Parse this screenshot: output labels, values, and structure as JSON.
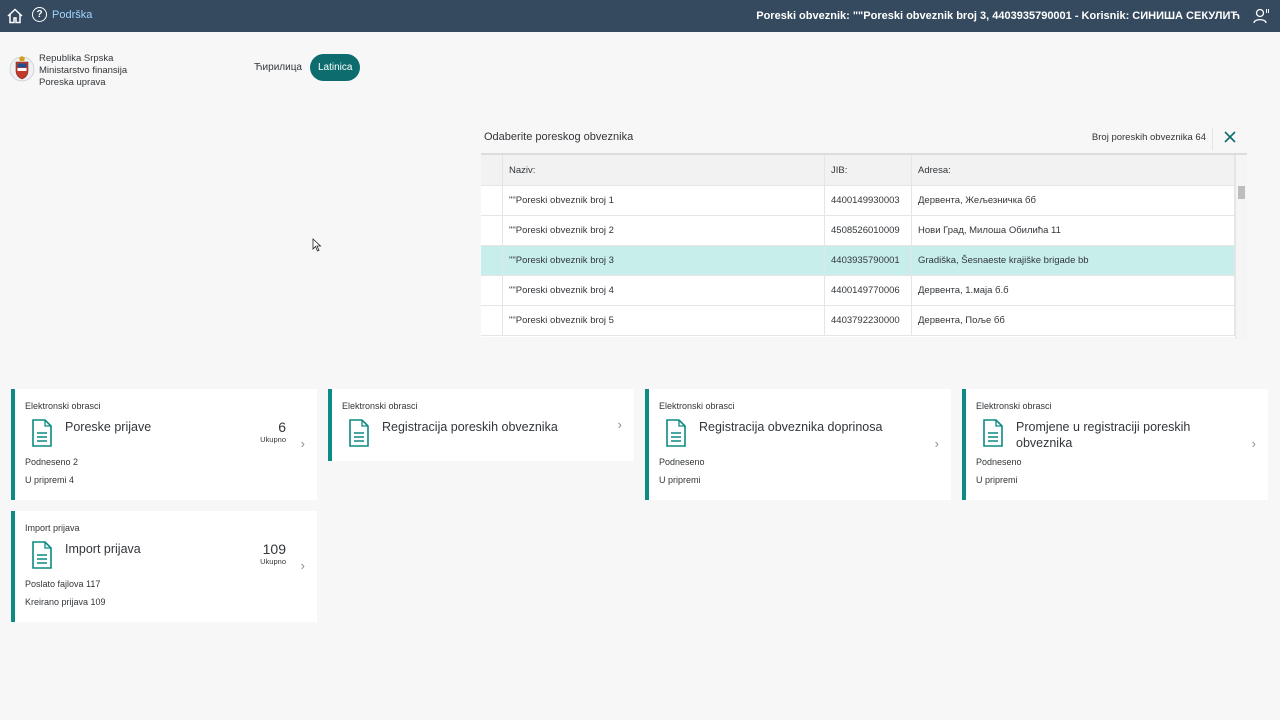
{
  "topbar": {
    "help_label": "Podrška",
    "context_info": "Poreski obveznik: \"\"Poreski obveznik broj 3, 4403935790001 - Korisnik: СИНИША СЕКУЛИЋ"
  },
  "header": {
    "org_lines": [
      "Republika Srpska",
      "Ministarstvo finansija",
      "Poreska uprava"
    ],
    "script_options": [
      "Ћирилица",
      "Latinica"
    ],
    "active_script": "Latinica"
  },
  "picker": {
    "title": "Odaberite poreskog obveznika",
    "count_label": "Broj poreskih obveznika 64",
    "columns": [
      "Naziv:",
      "JIB:",
      "Adresa:"
    ],
    "rows": [
      {
        "name": "\"\"Poreski obveznik broj 1",
        "jib": "4400149930003",
        "address": "Дервента, Жељезничка бб"
      },
      {
        "name": "\"\"Poreski obveznik broj 2",
        "jib": "4508526010009",
        "address": "Нови Град, Милоша Обилића 11"
      },
      {
        "name": "\"\"Poreski obveznik broj 3",
        "jib": "4403935790001",
        "address": "Gradiška, Šesnaeste krajiške brigade bb"
      },
      {
        "name": "\"\"Poreski obveznik broj 4",
        "jib": "4400149770006",
        "address": "Дервента, 1.маја б.б"
      },
      {
        "name": "\"\"Poreski obveznik broj 5",
        "jib": "4403792230000",
        "address": "Дервента, Поље бб"
      }
    ],
    "selected_row": 2
  },
  "tiles": [
    {
      "subtitle": "Elektronski obrasci",
      "title": "Poreske prijave",
      "kpi": "6",
      "kpi_label": "Ukupno",
      "footer1": "Podneseno 2",
      "footer2": "U pripremi 4"
    },
    {
      "subtitle": "Elektronski obrasci",
      "title": "Registracija poreskih obveznika"
    },
    {
      "subtitle": "Elektronski obrasci",
      "title": "Registracija obveznika doprinosa",
      "footer1": "Podneseno",
      "footer2": "U pripremi"
    },
    {
      "subtitle": "Elektronski obrasci",
      "title": "Promjene u registraciji poreskih obveznika",
      "footer1": "Podneseno",
      "footer2": "U pripremi"
    },
    {
      "subtitle": "Import prijava",
      "title": "Import prijava",
      "kpi": "109",
      "kpi_label": "Ukupno",
      "footer1": "Poslato fajlova 117",
      "footer2": "Kreirano prijava 109"
    }
  ],
  "colors": {
    "topbar": "#354a5f",
    "accent": "#0d6d6e",
    "selected_row": "#c7eeeb",
    "tile_border": "#0d8a84"
  },
  "icons": [
    "home-icon",
    "help-icon",
    "user-settings-icon",
    "close-icon",
    "document-icon",
    "chevron-right-icon"
  ]
}
